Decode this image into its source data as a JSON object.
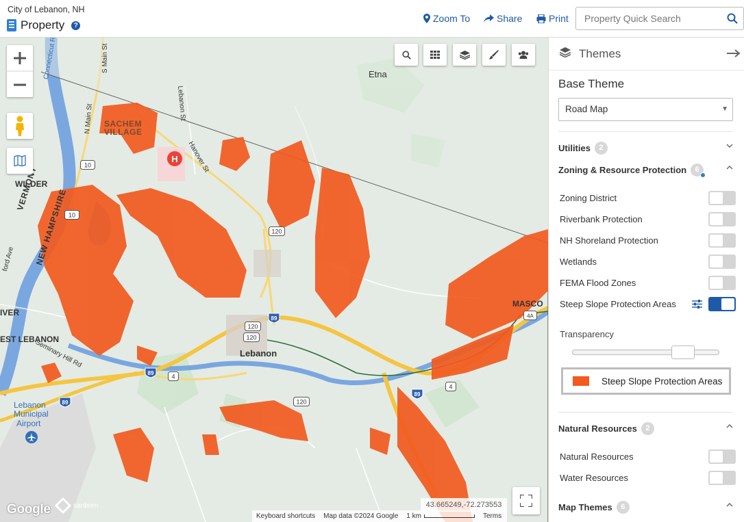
{
  "header": {
    "city": "City of Lebanon, NH",
    "title": "Property",
    "actions": {
      "zoom_to": "Zoom To",
      "share": "Share",
      "print": "Print"
    },
    "search": {
      "placeholder": "Property Quick Search",
      "value": ""
    }
  },
  "map": {
    "place_labels": {
      "etna": "Etna",
      "sachem_village_1": "SACHEM",
      "sachem_village_2": "VILLAGE",
      "wilder": "WILDER",
      "vermont": "VERMONT",
      "new_hampshire": "NEW HAMPSHIRE",
      "lebanon": "Lebanon",
      "west_lebanon": "EST LEBANON",
      "wilder_river": "IVER",
      "mascoma": "MASCO",
      "airport_1": "Lebanon",
      "airport_2": "Municipal",
      "airport_3": "Airport"
    },
    "road_labels": {
      "connecticut_river": "Connecticut River",
      "s_main_st": "S Main St",
      "n_main_st": "N Main St",
      "lebanon_st": "Lebanon St",
      "hanover_st": "Hanover St",
      "seminary_hill_rd": "Seminary Hill Rd",
      "ford_ave": "ford Ave"
    },
    "shields": {
      "r10a": "10",
      "r10b": "10",
      "r120a": "120",
      "r120b": "120",
      "r120c": "120",
      "r120d": "120",
      "i89a": "89",
      "i89b": "89",
      "i89c": "89",
      "i89d": "89",
      "r4a": "4",
      "r4b": "4",
      "r4c": "4A"
    },
    "coordinates": "43.665249,-72.273553",
    "attribution": {
      "keyboard": "Keyboard shortcuts",
      "data": "Map data ©2024 Google",
      "scale": "1 km",
      "terms": "Terms"
    },
    "google_logo": "Google",
    "sanborn": "sanborn",
    "colors": {
      "steep_slope": "#f25a1f",
      "water": "#7aa7e0",
      "highway": "#f5c542",
      "land": "#e4ebe4"
    }
  },
  "panel": {
    "title": "Themes",
    "base_theme_label": "Base Theme",
    "base_theme_value": "Road Map",
    "groups": {
      "utilities": {
        "label": "Utilities",
        "count": "2"
      },
      "zoning": {
        "label": "Zoning & Resource Protection",
        "count": "6"
      },
      "natural": {
        "label": "Natural Resources",
        "count": "2"
      },
      "map_themes": {
        "label": "Map Themes",
        "count": "6"
      }
    },
    "zoning_layers": [
      {
        "label": "Zoning District",
        "on": false
      },
      {
        "label": "Riverbank Protection",
        "on": false
      },
      {
        "label": "NH Shoreland Protection",
        "on": false
      },
      {
        "label": "Wetlands",
        "on": false
      },
      {
        "label": "FEMA Flood Zones",
        "on": false
      },
      {
        "label": "Steep Slope Protection Areas",
        "on": true
      }
    ],
    "natural_layers": [
      {
        "label": "Natural Resources",
        "on": false
      },
      {
        "label": "Water Resources",
        "on": false
      }
    ],
    "transparency_label": "Transparency",
    "transparency_value": 0.8,
    "legend_label": "Steep Slope Protection Areas"
  }
}
